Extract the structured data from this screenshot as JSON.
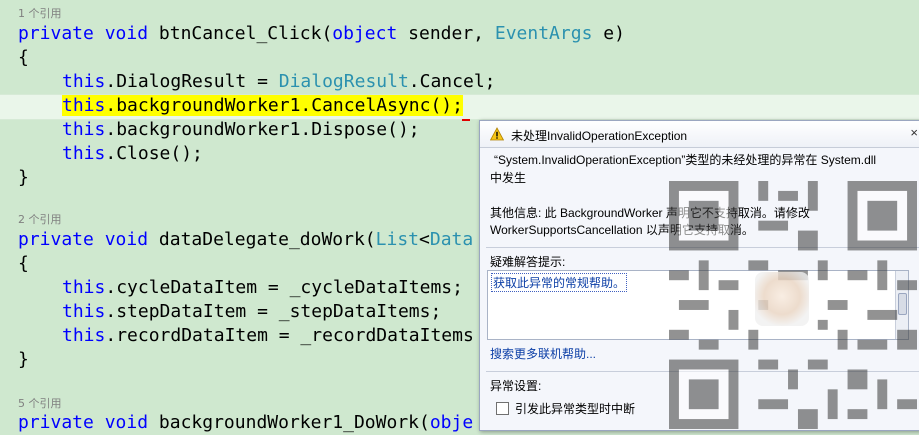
{
  "editor": {
    "refs": {
      "r1": "1 个引用",
      "r2": "2 个引用",
      "r3": "5 个引用"
    },
    "lines": {
      "l1": {
        "kw1": "private",
        "kw2": "void",
        "name": "btnCancel_Click(",
        "type1": "object",
        "rest1": " sender, ",
        "type2": "EventArgs",
        "rest2": " e)"
      },
      "l2": "{",
      "l3": {
        "kw": "this",
        "a": ".DialogResult = ",
        "ty": "DialogResult",
        "b": ".Cancel;"
      },
      "l4": {
        "kw": "this",
        "a": ".backgroundWorker1.CancelAsync();"
      },
      "l5": {
        "kw": "this",
        "a": ".backgroundWorker1.Dispose();"
      },
      "l6": {
        "kw": "this",
        "a": ".Close();"
      },
      "l7": "}",
      "l8": {
        "kw1": "private",
        "kw2": "void",
        "name": "dataDelegate_doWork(",
        "ty": "List",
        "lt": "<",
        "ty2": "Data"
      },
      "l9": "{",
      "l10": {
        "kw": "this",
        "a": ".cycleDataItem = _cycleDataItems;"
      },
      "l11": {
        "kw": "this",
        "a": ".stepDataItem = _stepDataItems;"
      },
      "l12": {
        "kw": "this",
        "a": ".recordDataItem = _recordDataItems"
      },
      "l13": "}",
      "l14": {
        "kw1": "private",
        "kw2": "void",
        "name": "backgroundWorker1_DoWork(",
        "tail": "obje"
      }
    }
  },
  "exception": {
    "title": "未处理InvalidOperationException",
    "close": "×",
    "message_line1": "“System.InvalidOperationException”类型的未经处理的异常在 System.dll",
    "message_line2": "中发生",
    "extra_line1": "其他信息: 此 BackgroundWorker 声明它不支持取消。请修改",
    "extra_line2": "WorkerSupportsCancellation 以声明它支持取消。",
    "tips_label": "疑难解答提示:",
    "tips_link": "获取此异常的常规帮助。",
    "more_help": "搜索更多联机帮助...",
    "settings_label": "异常设置:",
    "break_checkbox_label": "引发此异常类型时中断",
    "break_checked": false
  },
  "colors": {
    "background": "#cfe8cf",
    "keyword": "#0000ff",
    "type": "#2b91af",
    "highlight": "#ffff00",
    "link": "#0b3ea6"
  }
}
